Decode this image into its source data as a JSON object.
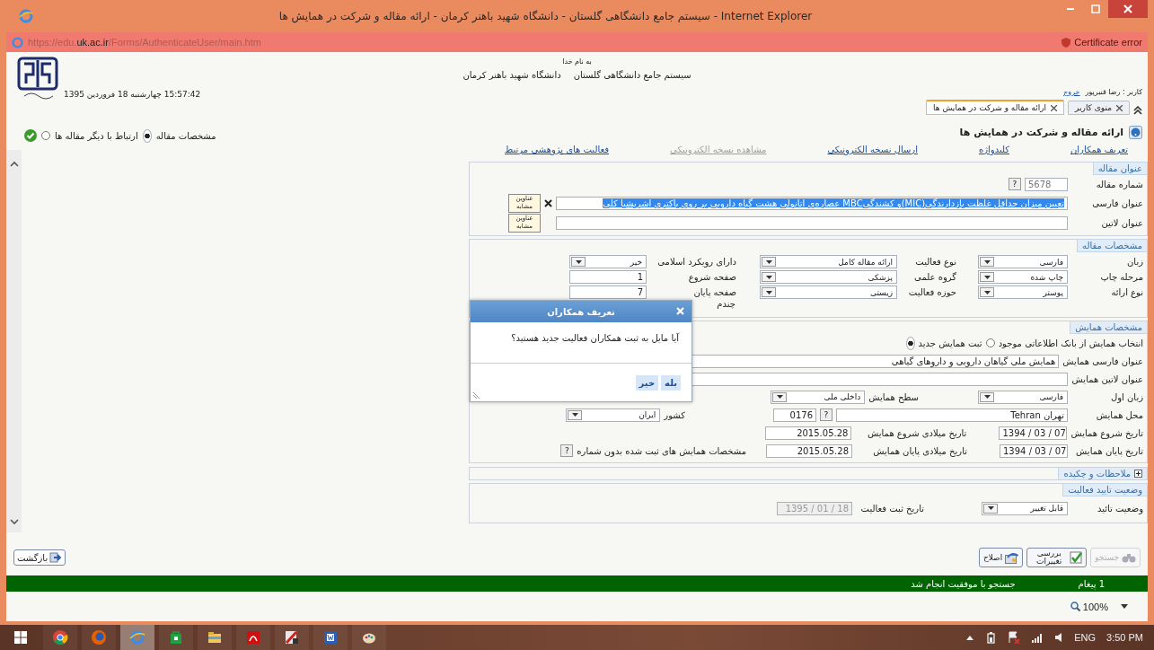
{
  "window": {
    "title": "سیستم جامع دانشگاهی گلستان - دانشگاه شهید باهنر کرمان - ارائه مقاله و شرکت در همایش ها - Internet Explorer"
  },
  "address_bar": {
    "url_prefix": "https://edu.",
    "url_domain": "uk.ac.ir",
    "url_path": "/Forms/AuthenticateUser/main.htm",
    "certificate_status": "Certificate error"
  },
  "header": {
    "datetime": "15:57:42 چهارشنبه 18 فروردین 1395",
    "basmala": "به نام خدا",
    "system_name": "سیستم جامع دانشگاهی گلستان",
    "university": "دانشگاه شهید باهنر کرمان",
    "user": "کاربر : رضا قنبرپور",
    "logout": "خروج"
  },
  "tabs": [
    {
      "label": "منوی کاربر",
      "selected": false
    },
    {
      "label": "ارائه مقاله و شرکت در همایش ها",
      "selected": true
    }
  ],
  "view_options": [
    {
      "label": "مشخصات مقاله",
      "selected": true
    },
    {
      "label": "ارتباط با دیگر مقاله ها",
      "selected": false
    }
  ],
  "page_title": "ارائه مقاله و شرکت در همایش ها",
  "links": [
    {
      "label": "تعریف همکاران",
      "disabled": false
    },
    {
      "label": "کلیدواژه",
      "disabled": false
    },
    {
      "label": "ارسال نسخه الکترونیکی",
      "disabled": false
    },
    {
      "label": "مشاهده نسخه الکترونیکی",
      "disabled": true
    },
    {
      "label": "فعالیت های پژوهشی مرتبط",
      "disabled": false
    }
  ],
  "article_title": {
    "legend": "عنوان مقاله",
    "number_label": "شماره مقاله",
    "number": "5678",
    "number_help": "?",
    "persian_label": "عنوان فارسی",
    "persian_value": "تعیین میزان حداقل غلظت بازدارندگی(MIC)و کشندگیMBC عصاره‌ی اتانولی هشت گیاه دارویی بر روی باکتری اشریشیا کلی",
    "persian_selected": true,
    "persian_similar": "عناوین مشابه",
    "latin_label": "عنوان لاتین",
    "latin_similar": "عناوین مشابه"
  },
  "article_details": {
    "legend": "مشخصات مقاله",
    "fields": [
      {
        "label": "زبان",
        "value": "فارسی",
        "kind": "select"
      },
      {
        "label": "نوع فعالیت",
        "value": "ارائه مقاله کامل",
        "kind": "select"
      },
      {
        "label": "دارای رویکرد اسلامی",
        "value": "خیر",
        "kind": "select"
      },
      {
        "label": "مرحله چاپ",
        "value": "چاپ شده",
        "kind": "select"
      },
      {
        "label": "گروه علمی",
        "value": "پزشکی",
        "kind": "select"
      },
      {
        "label": "صفحه شروع",
        "value": "1",
        "kind": "text"
      },
      {
        "label": "نوع ارائه",
        "value": "پوستر",
        "kind": "select"
      },
      {
        "label": "حوزه فعالیت",
        "value": "زیستی",
        "kind": "select"
      },
      {
        "label": "صفحه پایان",
        "value": "7",
        "kind": "text"
      }
    ],
    "partial_label": "چندم"
  },
  "conference": {
    "legend": "مشخصات همایش",
    "source_options": [
      {
        "label": "انتخاب همایش از بانک اطلاعاتی موجود",
        "selected": false
      },
      {
        "label": "ثبت همایش جدید",
        "selected": true
      }
    ],
    "persian_title_label": "عنوان فارسی همایش",
    "persian_title": "همایش ملی گیاهان دارویی و داروهای گیاهی",
    "latin_title_label": "عنوان لاتین همایش",
    "language_label": "زبان اول",
    "language": "فارسی",
    "scope_label": "سطح همایش",
    "scope": "داخلی ملی",
    "place_label": "محل همایش",
    "place": "تهران Tehran",
    "place_help": "?",
    "place_code": "0176",
    "country_label": "کشور",
    "country": "ایران",
    "start_label": "تاریخ شروع همایش",
    "start_date": "1394 / 03 / 07",
    "start_greg_label": "تاریخ میلادی شروع همایش",
    "start_greg": "2015.05.28",
    "end_label": "تاریخ پایان همایش",
    "end_date": "1394 / 03 / 07",
    "end_greg_label": "تاریخ میلادی پایان همایش",
    "end_greg": "2015.05.28",
    "unnumbered_label": "مشخصات همایش های ثبت شده بدون شماره",
    "unnumbered_help": "?"
  },
  "notes": {
    "label": "ملاحظات و چکیده",
    "expanded": false
  },
  "approval": {
    "legend": "وضعیت تایید فعالیت",
    "status_label": "وضعیت تائید",
    "status": "قابل تغییر",
    "date_label": "تاریخ ثبت فعالیت",
    "date": "1395 / 01 / 18"
  },
  "dialog": {
    "title": "تعریف همکاران",
    "message": "آیا مایل به ثبت همکاران فعالیت جدید هستید؟",
    "buttons": [
      "بله",
      "خیر"
    ]
  },
  "back_button": "بازگشت",
  "actions": [
    {
      "label": "جستجو",
      "disabled": true,
      "kind": "search"
    },
    {
      "label": "بررسی تغییرات",
      "disabled": false,
      "kind": "review"
    },
    {
      "label": "اصلاح",
      "disabled": false,
      "kind": "edit"
    }
  ],
  "status_message": {
    "count": "1 پیغام",
    "text": "جستجو با موفقیت انجام شد"
  },
  "zoom": "100%",
  "taskbar": {
    "apps": [
      {
        "kind": "chrome",
        "selected": false
      },
      {
        "kind": "firefox",
        "selected": false
      },
      {
        "kind": "ie",
        "selected": true
      },
      {
        "kind": "store",
        "selected": false
      },
      {
        "kind": "folder",
        "selected": false
      },
      {
        "kind": "pdf",
        "selected": false
      },
      {
        "kind": "tool",
        "selected": false
      },
      {
        "kind": "word",
        "selected": false
      },
      {
        "kind": "paint",
        "selected": false
      }
    ],
    "language": "ENG",
    "time": "3:50 PM"
  }
}
